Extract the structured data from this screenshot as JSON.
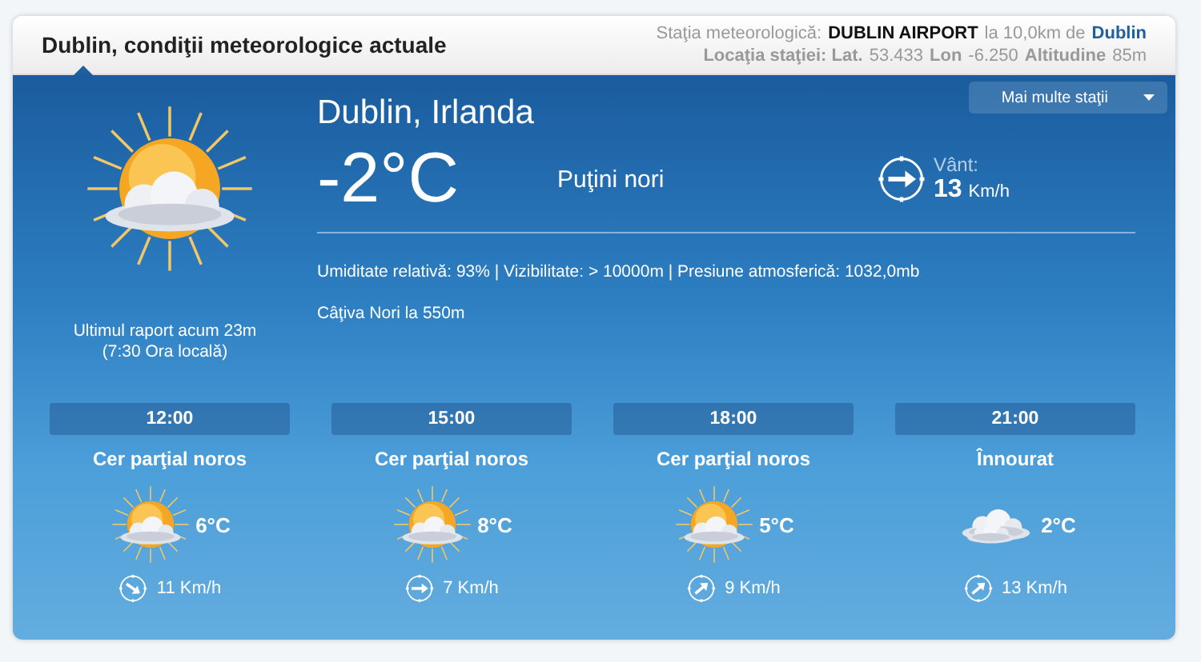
{
  "header": {
    "title": "Dublin, condiţii meteorologice actuale",
    "station_label": "Staţia meteorologică:",
    "station_name": "DUBLIN AIRPORT",
    "distance_text": "la 10,0km de",
    "city_link": "Dublin",
    "location_line": "**Locaţia staţiei: Lat.** 53.433 **Lon** -6.250 **Altitudine** 85m"
  },
  "stations_dropdown": {
    "label": "Mai multe staţii"
  },
  "current": {
    "kind": "partly_cloudy",
    "report": "Ultimul raport acum 23m",
    "local_time": "(7:30 Ora locală)",
    "location": "Dublin, Irlanda",
    "temperature": "-2°C",
    "condition": "Puţini nori",
    "wind_label": "Vânt:",
    "wind_speed": "13",
    "wind_unit": "Km/h",
    "details": "Umiditate relativă: 93% | Vizibilitate: > 10000m | Presiune atmosferică: 1032,0mb",
    "clouds": "Câţiva Nori la 550m"
  },
  "forecast": [
    {
      "time": "12:00",
      "condition": "Cer parţial noros",
      "kind": "partly_cloudy",
      "temperature": "6°C",
      "wind": "11 Km/h"
    },
    {
      "time": "15:00",
      "condition": "Cer parţial noros",
      "kind": "partly_cloudy",
      "temperature": "8°C",
      "wind": "7 Km/h"
    },
    {
      "time": "18:00",
      "condition": "Cer parţial noros",
      "kind": "partly_cloudy",
      "temperature": "5°C",
      "wind": "9 Km/h"
    },
    {
      "time": "21:00",
      "condition": "Înnourat",
      "kind": "cloudy",
      "temperature": "2°C",
      "wind": "13 Km/h"
    }
  ]
}
